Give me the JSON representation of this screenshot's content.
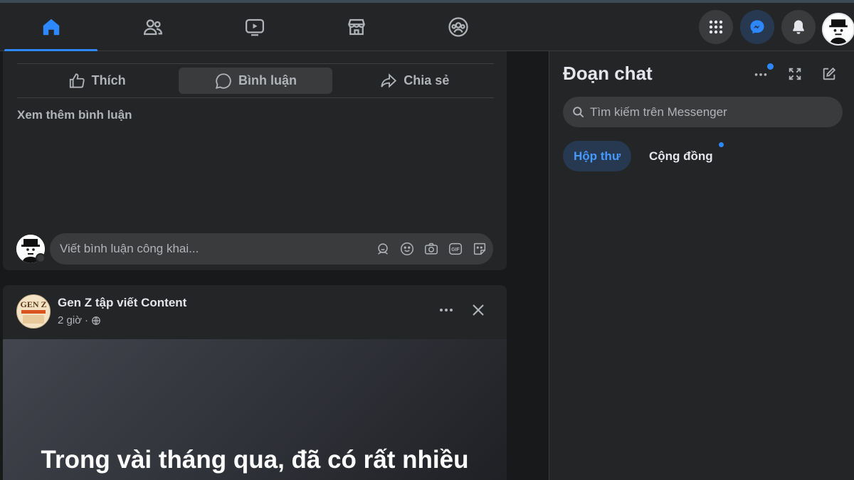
{
  "colors": {
    "accent": "#2d88ff",
    "surface": "#242526",
    "background": "#18191a",
    "text": "#e4e6eb",
    "muted": "#b0b3b8"
  },
  "nav": {
    "tabs": [
      {
        "name": "home",
        "icon": "home-icon",
        "active": true
      },
      {
        "name": "friends",
        "icon": "friends-icon",
        "active": false
      },
      {
        "name": "watch",
        "icon": "video-icon",
        "active": false
      },
      {
        "name": "marketplace",
        "icon": "store-icon",
        "active": false
      },
      {
        "name": "groups",
        "icon": "groups-icon",
        "active": false
      }
    ],
    "right_buttons": [
      "menu-grid-icon",
      "messenger-icon",
      "bell-icon",
      "avatar"
    ]
  },
  "post1": {
    "actions": {
      "like": "Thích",
      "comment": "Bình luận",
      "share": "Chia sẻ"
    },
    "see_more_comments": "Xem thêm bình luận",
    "comment_placeholder": "Viết bình luận công khai..."
  },
  "post2": {
    "page_name": "Gen Z tập viết Content",
    "avatar_text": "GEN Z",
    "time": "2 giờ",
    "separator": "·",
    "headline": "Trong vài tháng qua, đã có rất nhiều"
  },
  "chat": {
    "title": "Đoạn chat",
    "search_placeholder": "Tìm kiếm trên Messenger",
    "tabs": {
      "inbox": "Hộp thư",
      "community": "Cộng đồng"
    }
  }
}
